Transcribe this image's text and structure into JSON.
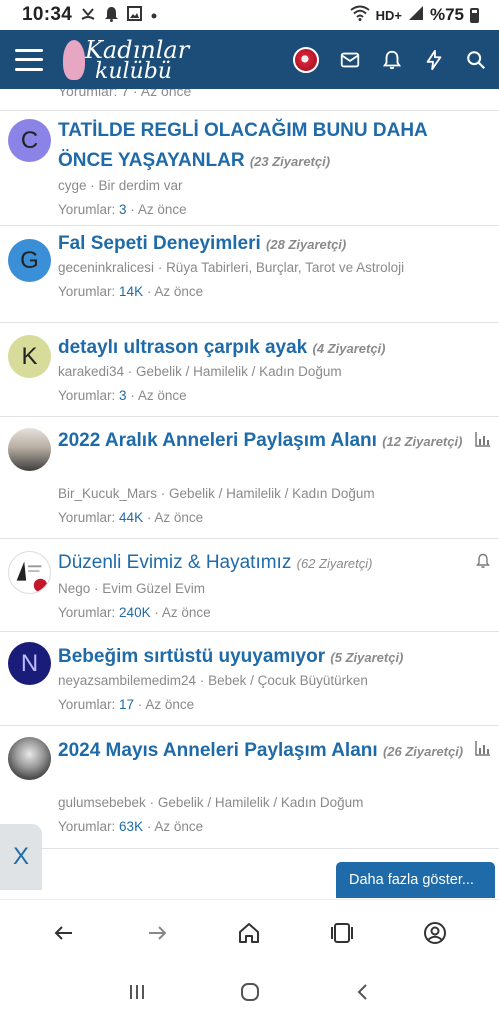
{
  "status_bar": {
    "time": "10:34",
    "network": "HD+",
    "battery": "%75",
    "icons": [
      "missed-call-icon",
      "notification-icon",
      "image-icon",
      "dot-icon",
      "wifi-icon",
      "signal-icon",
      "battery-icon"
    ]
  },
  "header": {
    "logo_line1": "Kadınlar",
    "logo_line2": "kulübü",
    "icons": [
      "menu-icon",
      "avatar",
      "mail-icon",
      "bell-icon",
      "bolt-icon",
      "search-icon"
    ],
    "brand_color": "#1c4d78"
  },
  "clipped_meta": "Yorumlar: 7 · Az önce",
  "topics": [
    {
      "avatar_letter": "C",
      "avatar_color": "#8b83e6",
      "title": "TATİLDE REGLİ OLACAĞIM BUNU DAHA ÖNCE YAŞAYANLAR",
      "visitors": "(23 Ziyaretçi)",
      "author": "cyge",
      "forum": "Bir derdim var",
      "comments_label": "Yorumlar:",
      "comments": "3",
      "time": "Az önce"
    },
    {
      "avatar_letter": "G",
      "avatar_color": "#3b8fd6",
      "title": "Fal Sepeti Deneyimleri",
      "visitors": "(28 Ziyaretçi)",
      "author": "geceninkralicesi",
      "forum": "Rüya Tabirleri, Burçlar, Tarot ve Astroloji",
      "comments_label": "Yorumlar:",
      "comments": "14K",
      "time": "Az önce"
    },
    {
      "avatar_letter": "K",
      "avatar_color": "#d8dc9a",
      "title": "detaylı ultrason çarpık ayak",
      "visitors": "(4 Ziyaretçi)",
      "author": "karakedi34",
      "forum": "Gebelik / Hamilelik / Kadın Doğum",
      "comments_label": "Yorumlar:",
      "comments": "3",
      "time": "Az önce"
    },
    {
      "avatar_letter": "",
      "avatar_color": "#b9aea3",
      "title": "2022 Aralık Anneleri Paylaşım Alanı",
      "visitors": "(12 Ziyaretçi)",
      "author": "Bir_Kucuk_Mars",
      "forum": "Gebelik / Hamilelik / Kadın Doğum",
      "comments_label": "Yorumlar:",
      "comments": "44K",
      "time": "Az önce",
      "side_icon": "chart-icon"
    },
    {
      "avatar_letter": "",
      "avatar_color": "#ffffff",
      "title": "Düzenli Evimiz & Hayatımız",
      "visitors": "(62 Ziyaretçi)",
      "author": "Nego",
      "forum": "Evim Güzel Evim",
      "comments_label": "Yorumlar:",
      "comments": "240K",
      "time": "Az önce",
      "side_icon": "bell-icon"
    },
    {
      "avatar_letter": "N",
      "avatar_color": "#1a1c7a",
      "title": "Bebeğim sırtüstü uyuyamıyor",
      "visitors": "(5 Ziyaretçi)",
      "author": "neyazsambilemedim24",
      "forum": "Bebek / Çocuk Büyütürken",
      "comments_label": "Yorumlar:",
      "comments": "17",
      "time": "Az önce"
    },
    {
      "avatar_letter": "",
      "avatar_color": "#6a6a6a",
      "title": "2024 Mayıs Anneleri Paylaşım Alanı",
      "visitors": "(26 Ziyaretçi)",
      "author": "gulumsebebek",
      "forum": "Gebelik / Hamilelik / Kadın Doğum",
      "comments_label": "Yorumlar:",
      "comments": "63K",
      "time": "Az önce",
      "side_icon": "chart-icon"
    }
  ],
  "close_tab": "X",
  "more_button": "Daha fazla göster...",
  "browser_bar": [
    "back-icon",
    "forward-icon",
    "home-icon",
    "tabs-icon",
    "account-icon"
  ],
  "system_nav": [
    "recents-icon",
    "home-circle-icon",
    "back-chevron-icon"
  ]
}
